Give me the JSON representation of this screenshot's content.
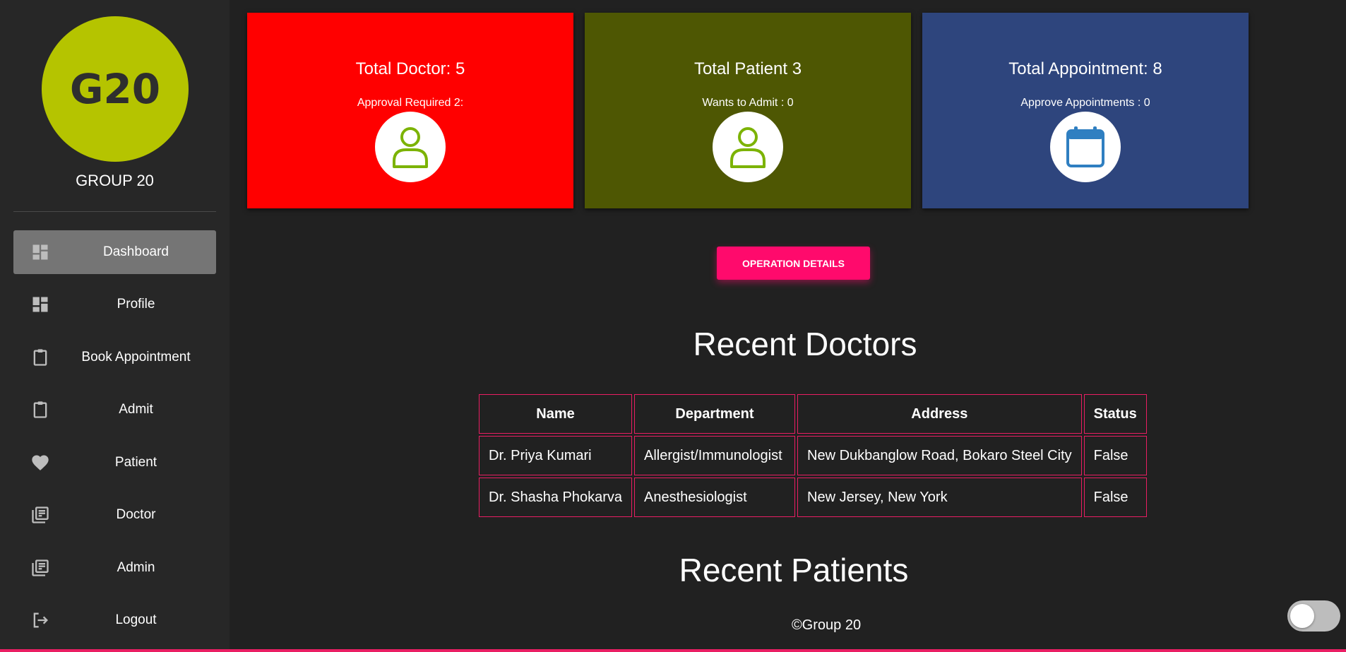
{
  "sidebar": {
    "logo_text": "G20",
    "logo_color": "#b5c400",
    "group_name": "GROUP 20",
    "items": [
      {
        "label": "Dashboard",
        "icon": "dashboard-icon",
        "active": true
      },
      {
        "label": "Profile",
        "icon": "dashboard-icon"
      },
      {
        "label": "Book Appointment",
        "icon": "clipboard-icon"
      },
      {
        "label": "Admit",
        "icon": "clipboard-icon"
      },
      {
        "label": "Patient",
        "icon": "heart-icon"
      },
      {
        "label": "Doctor",
        "icon": "library-books-icon"
      },
      {
        "label": "Admin",
        "icon": "library-books-icon"
      },
      {
        "label": "Logout",
        "icon": "logout-icon"
      }
    ]
  },
  "cards": [
    {
      "title": "Total Doctor: 5",
      "subtitle": "Approval Required 2:",
      "icon": "user-icon",
      "color": "#ff0000"
    },
    {
      "title": "Total Patient 3",
      "subtitle": "Wants to Admit : 0",
      "icon": "user-icon",
      "color": "#4e5703"
    },
    {
      "title": "Total Appointment: 8",
      "subtitle": "Approve Appointments : 0",
      "icon": "calendar-icon",
      "color": "#2e457d"
    }
  ],
  "operation_button": "OPERATION DETAILS",
  "recent_doctors": {
    "title": "Recent Doctors",
    "columns": [
      "Name",
      "Department",
      "Address",
      "Status"
    ],
    "rows": [
      [
        "Dr. Priya Kumari",
        "Allergist/Immunologist",
        "New Dukbanglow Road, Bokaro Steel City",
        "False"
      ],
      [
        "Dr. Shasha Phokarva",
        "Anesthesiologist",
        "New Jersey, New York",
        "False"
      ]
    ]
  },
  "recent_patients": {
    "title": "Recent Patients"
  },
  "footer": "©Group 20",
  "accent_color": "#e91e63",
  "button_color": "#ff0a6c",
  "theme_toggle": {
    "state": "off"
  }
}
